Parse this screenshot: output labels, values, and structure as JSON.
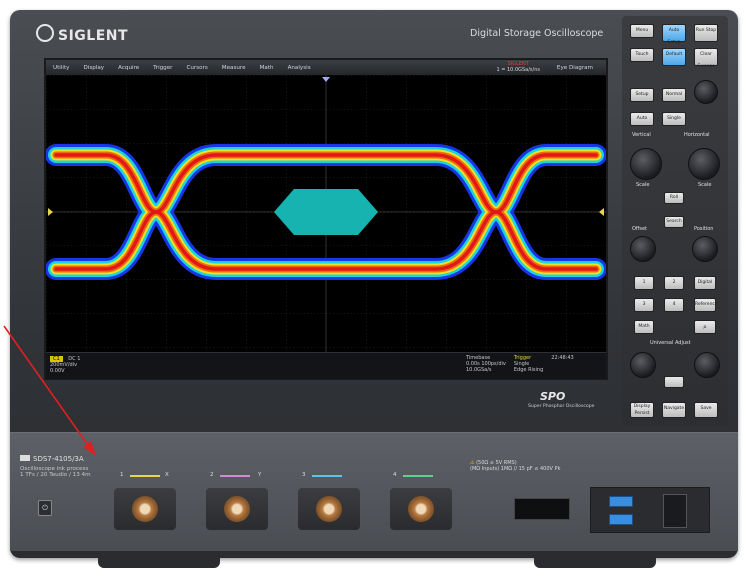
{
  "device": {
    "brand": "SIGLENT",
    "product_title": "Digital Storage Oscilloscope",
    "model": "SDS7-4105/3A",
    "model_sub": "Oscilloscope ink process",
    "specs": "1 TFs / 20 Teudio / 13 4m",
    "spo_logo": "SPO",
    "spo_caption": "Super Phosphor Oscilloscope",
    "warning_line1": "(50Ω ≤ 5V RMS)",
    "warning_line2": "(MΩ Inputs) 1MΩ // 15 pF ≤ 400V Pk"
  },
  "screen": {
    "menu": [
      "Utility",
      "Display",
      "Acquire",
      "Trigger",
      "Cursors",
      "Measure",
      "Math",
      "Analysis"
    ],
    "status_brand": "SIGLENT",
    "status_line": "1 = 10.0GSa/s/ns",
    "status_right": "Eye Diagram",
    "info": {
      "channel_tag": "C1",
      "channel_values": [
        "DC 1",
        "200mV/div",
        "0.00V"
      ],
      "timebase_label": "Timebase",
      "timebase_values": [
        "0.00s",
        "100ps/div",
        "10.0GSa/s"
      ],
      "trigger_label": "Trigger",
      "trigger_values": [
        "Single",
        "Edge",
        "Rising"
      ],
      "time": "22:48:43"
    }
  },
  "panel": {
    "buttons_top": [
      "Menu",
      "Auto Setup",
      "Run Stop",
      "Touch",
      "Default",
      "Clear Sweeps"
    ],
    "buttons_mid": [
      "Setup",
      "Normal",
      "Auto",
      "Single"
    ],
    "section_vertical": "Vertical",
    "section_horizontal": "Horizontal",
    "knob_labels": [
      "Scale",
      "Scale",
      "Offset",
      "Position"
    ],
    "roll_label": "Roll",
    "search_label": "Search",
    "channel_buttons": [
      "1",
      "2",
      "Digital",
      "3",
      "4",
      "Reference",
      "Math"
    ],
    "section_universal": "Universal Adjust",
    "bottom_buttons": [
      "Display Persist",
      "Navigate",
      "Save"
    ]
  },
  "front": {
    "channels": [
      {
        "label": "1",
        "sub": "X",
        "color": "#e6d64a"
      },
      {
        "label": "2",
        "sub": "Y",
        "color": "#d08ad6"
      },
      {
        "label": "3",
        "sub": "",
        "color": "#5ac4e8"
      },
      {
        "label": "4",
        "sub": "",
        "color": "#5ad08e"
      }
    ]
  }
}
